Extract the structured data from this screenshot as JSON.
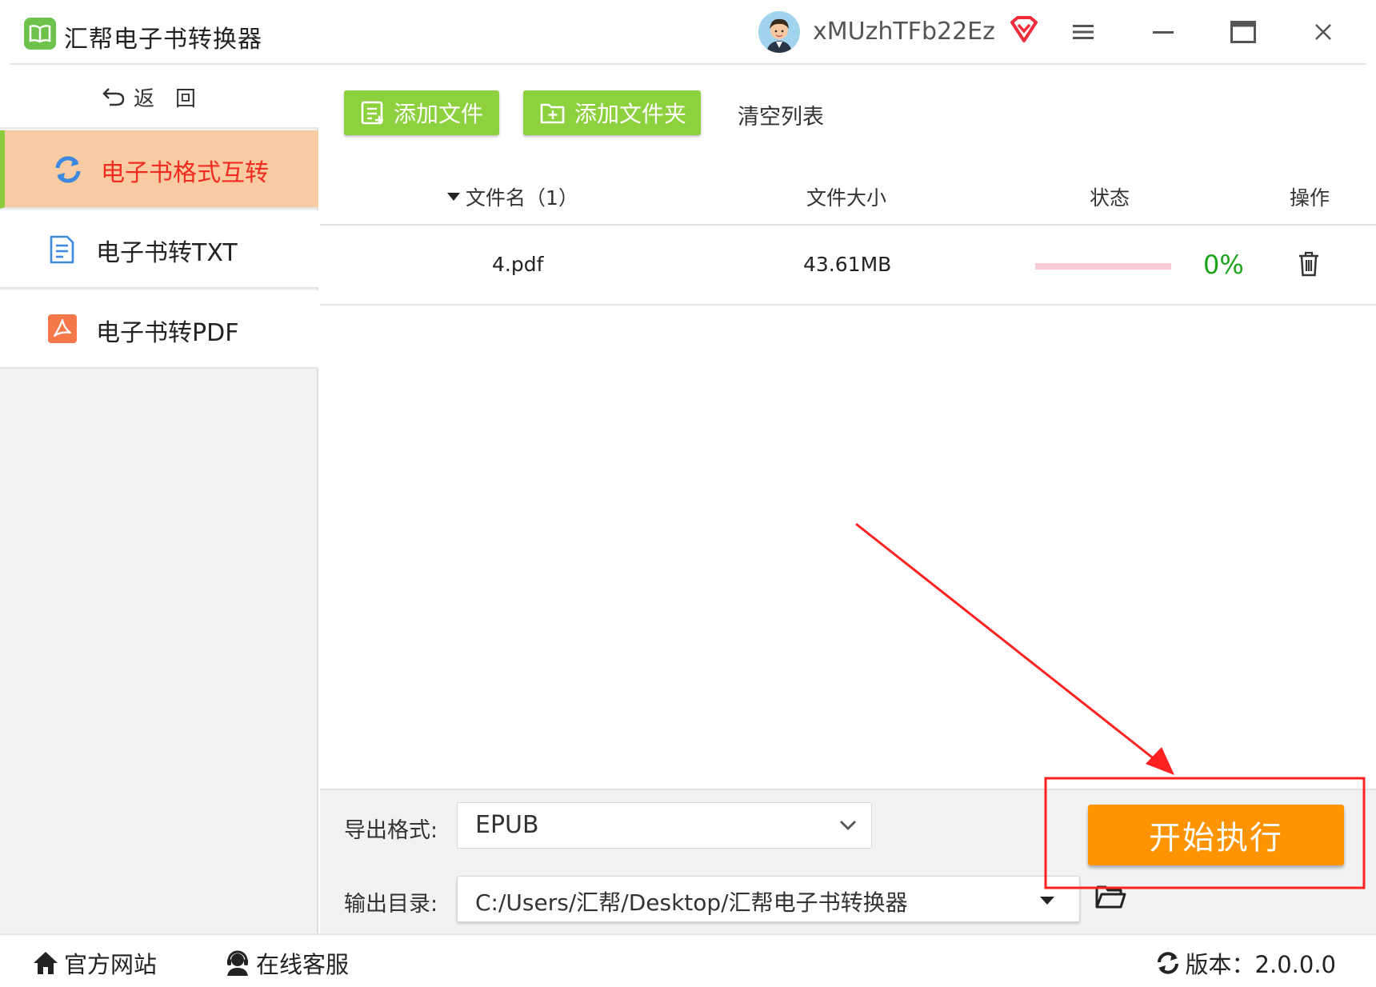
{
  "app": {
    "title": "汇帮电子书转换器"
  },
  "user": {
    "name": "xMUzhTFb22Ez"
  },
  "sidebar": {
    "back_label": "返回",
    "items": [
      {
        "label": "电子书格式互转",
        "active": true,
        "icon": "refresh-icon"
      },
      {
        "label": "电子书转TXT",
        "active": false,
        "icon": "document-icon"
      },
      {
        "label": "电子书转PDF",
        "active": false,
        "icon": "pdf-icon"
      }
    ]
  },
  "toolbar": {
    "add_file": "添加文件",
    "add_folder": "添加文件夹",
    "clear_list": "清空列表"
  },
  "table": {
    "headers": {
      "name": "文件名（1）",
      "size": "文件大小",
      "status": "状态",
      "action": "操作"
    },
    "rows": [
      {
        "name": "4.pdf",
        "size": "43.61MB",
        "progress_fraction": 0,
        "percent": "0%"
      }
    ]
  },
  "output": {
    "format_label": "导出格式:",
    "format_value": "EPUB",
    "dir_label": "输出目录:",
    "dir_value": "C:/Users/汇帮/Desktop/汇帮电子书转换器"
  },
  "start_button": "开始执行",
  "statusbar": {
    "website": "官方网站",
    "support": "在线客服",
    "version": "版本：2.0.0.0"
  },
  "colors": {
    "green": "#8dd13f",
    "orange": "#ff9300",
    "active_bg": "#f8cba2",
    "active_text": "#f02b1f",
    "annotation_red": "#ff2020",
    "percent_green": "#19a319"
  }
}
